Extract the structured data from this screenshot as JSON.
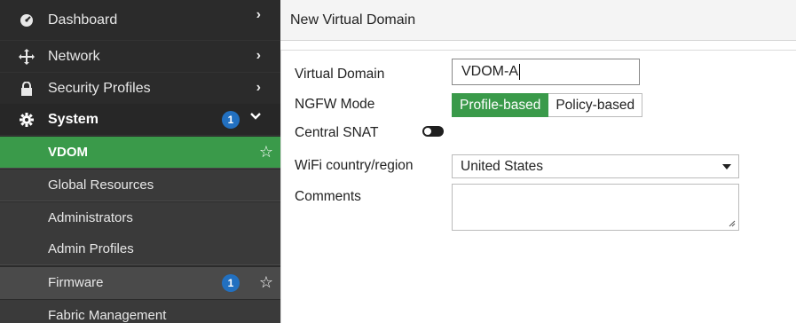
{
  "sidebar": {
    "items": [
      {
        "label": "Dashboard",
        "icon": "dashboard-gauge-icon"
      },
      {
        "label": "Network",
        "icon": "network-arrows-icon"
      },
      {
        "label": "Security Profiles",
        "icon": "lock-icon"
      },
      {
        "label": "System",
        "icon": "gear-icon",
        "badge": "1"
      }
    ],
    "sub_items": [
      {
        "label": "VDOM",
        "active": true
      },
      {
        "label": "Global Resources"
      },
      {
        "label": "Administrators"
      },
      {
        "label": "Admin Profiles"
      },
      {
        "label": "Firmware",
        "badge": "1"
      },
      {
        "label": "Fabric Management"
      }
    ]
  },
  "page": {
    "title": "New Virtual Domain"
  },
  "form": {
    "virtual_domain_label": "Virtual Domain",
    "virtual_domain_value": "VDOM-A",
    "ngfw_mode_label": "NGFW Mode",
    "ngfw_options": [
      "Profile-based",
      "Policy-based"
    ],
    "ngfw_selected": "Profile-based",
    "central_snat_label": "Central SNAT",
    "central_snat_enabled": false,
    "wifi_label": "WiFi country/region",
    "wifi_value": "United States",
    "comments_label": "Comments",
    "comments_value": ""
  },
  "colors": {
    "accent_green": "#3a9a4a",
    "sidebar_bg": "#2b2b2b",
    "badge_blue": "#2270c0"
  }
}
